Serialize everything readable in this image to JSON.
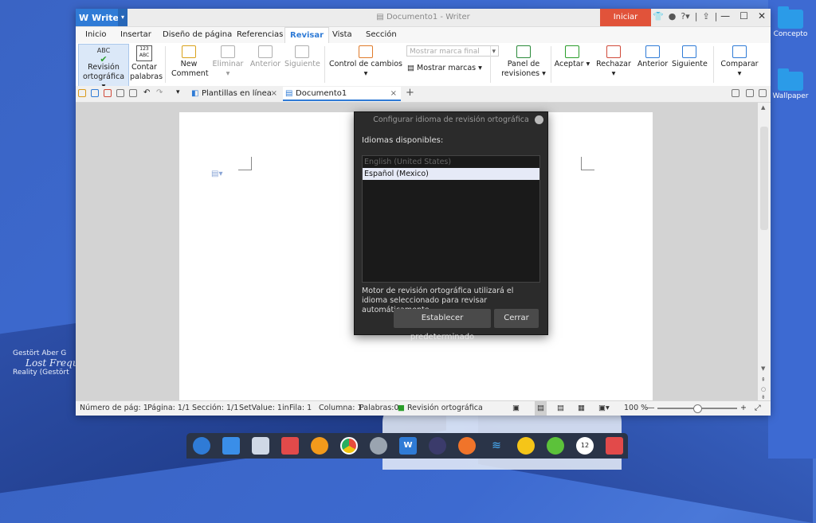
{
  "desktop": {
    "icons": [
      {
        "label": "Concepto",
        "icon": "folder-icon"
      },
      {
        "label": "Wallpaper",
        "icon": "folder-icon"
      }
    ],
    "signature": {
      "line1": "Gestört Aber G",
      "line2": "Lost Frequ",
      "line3": "Reality (Gestört"
    }
  },
  "titlebar": {
    "app_name": "Writer",
    "title": "Documento1 - Writer",
    "login_label": "Iniciar sesión",
    "help_label": "?"
  },
  "menu": {
    "tabs": [
      "Inicio",
      "Insertar",
      "Diseño de página",
      "Referencias",
      "Revisar",
      "Vista",
      "Sección"
    ],
    "active_tab": "Revisar"
  },
  "ribbon": {
    "spellcheck": {
      "line1": "Revisión",
      "line2": "ortográfica ▾",
      "icon_text": "ABC"
    },
    "wordcount": {
      "line1": "Contar",
      "line2": "palabras",
      "icon_text": "123\nABC"
    },
    "new_comment": {
      "line1": "New",
      "line2": "Comment"
    },
    "delete": "Eliminar ▾",
    "previous_comment": "Anterior",
    "next_comment": "Siguiente",
    "track_changes": "Control de cambios ▾",
    "markup_dropdown": "Mostrar marca final",
    "show_markup": "Mostrar marcas ▾",
    "review_pane": {
      "line1": "Panel de",
      "line2": "revisiones ▾"
    },
    "accept": "Aceptar ▾",
    "reject": "Rechazar ▾",
    "previous_change": "Anterior",
    "next_change": "Siguiente",
    "compare": "Comparar ▾"
  },
  "doc_tabs": {
    "templates": "Plantillas en línea",
    "document": "Documento1",
    "close": "×",
    "add": "+"
  },
  "status": {
    "page_number": "Número de pág: 1",
    "page": "Página: 1/1",
    "section": "Sección: 1/1",
    "setvalue": "SetValue: 1in",
    "row": "Fila: 1",
    "column": "Columna: 1",
    "words": "Palabras:0",
    "spellcheck": "Revisión ortográfica",
    "zoom": "100 %",
    "zoom_minus": "—",
    "zoom_plus": "+",
    "zoom_level": 0.5
  },
  "dialog": {
    "title": "Configurar idioma de revisión ortográfica",
    "label": "Idiomas disponibles:",
    "languages": [
      {
        "name": "English (United States)",
        "state": "disabled"
      },
      {
        "name": "Español (Mexico)",
        "state": "selected"
      }
    ],
    "description": "Motor de revisión ortográfica utilizará el idioma seleccionado para revisar automáticamente.",
    "default_button": "Establecer predeterminado",
    "close_button": "Cerrar"
  },
  "dock": {
    "apps": [
      "launcher-icon",
      "multitask-icon",
      "files-icon",
      "store-icon",
      "music-icon",
      "chrome-icon",
      "settings-icon",
      "wps-icon",
      "media-icon",
      "upload-icon",
      "wifi-icon",
      "update-icon",
      "power-icon",
      "clock-icon",
      "trash-icon"
    ],
    "clock_text": "12"
  },
  "colors": {
    "accent": "#2f7bd6",
    "login": "#e1533a",
    "dialog_bg": "#2b2b2b",
    "desktop": "#3d6ad0"
  }
}
